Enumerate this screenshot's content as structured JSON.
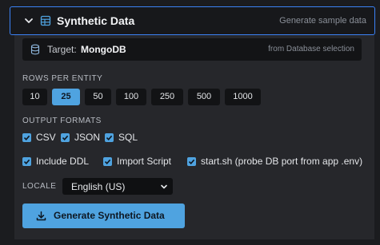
{
  "header": {
    "title": "Synthetic Data",
    "hint": "Generate sample data",
    "icons": [
      "chevron-down-icon",
      "table-icon"
    ]
  },
  "target": {
    "label": "Target:",
    "value": "MongoDB",
    "source": "from Database selection",
    "icon": "database-icon"
  },
  "rows": {
    "label": "ROWS PER ENTITY",
    "options": [
      "10",
      "25",
      "50",
      "100",
      "250",
      "500",
      "1000"
    ],
    "selected": "25"
  },
  "formats": {
    "label": "OUTPUT FORMATS",
    "items": [
      {
        "label": "CSV",
        "checked": true
      },
      {
        "label": "JSON",
        "checked": true
      },
      {
        "label": "SQL",
        "checked": true
      }
    ]
  },
  "extras": {
    "items": [
      {
        "label": "Include DDL",
        "checked": true
      },
      {
        "label": "Import Script",
        "checked": true
      },
      {
        "label": "start.sh (probe DB port from app .env)",
        "checked": true
      }
    ]
  },
  "locale": {
    "label": "LOCALE",
    "value": "English (US)"
  },
  "generate": {
    "label": "Generate Synthetic Data",
    "icon": "download-icon"
  },
  "colors": {
    "accent": "#4fa3e0",
    "focus_border": "#3b82f6",
    "background": "#1b1c1f",
    "panel": "#26272b"
  }
}
